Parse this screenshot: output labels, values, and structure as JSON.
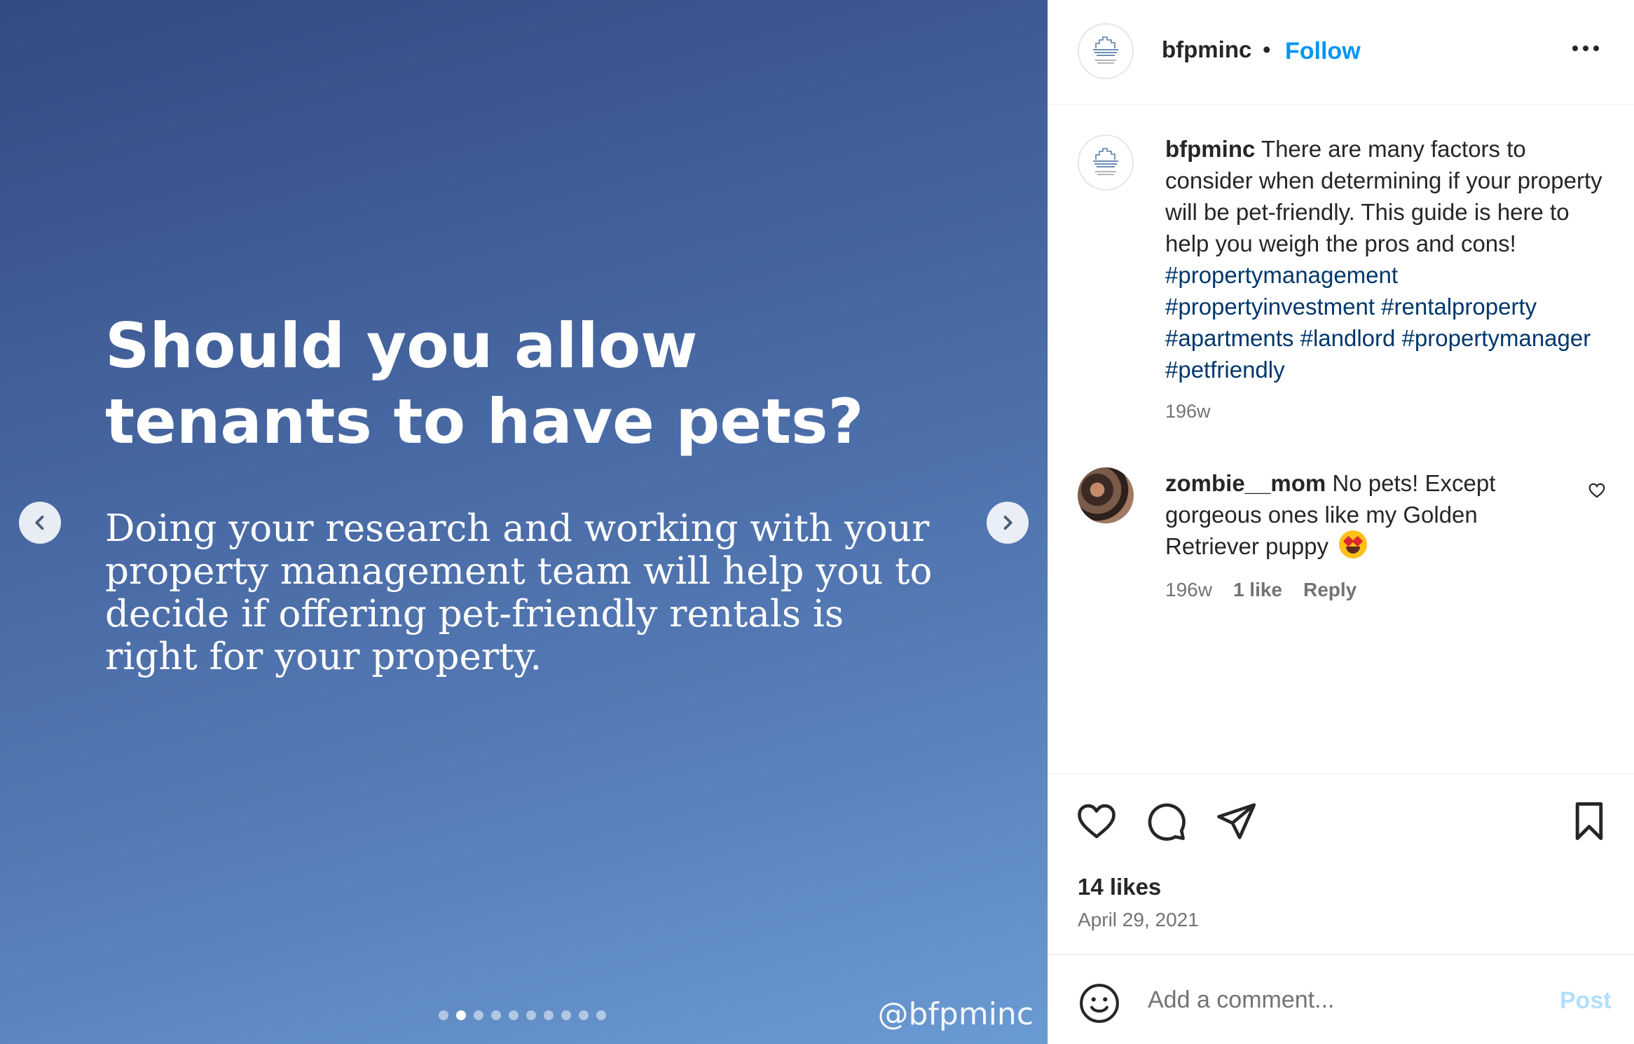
{
  "post": {
    "slide": {
      "title": "Should you allow tenants to have pets?",
      "body": "Doing your research and working with your property management team will help you to decide if offering pet-friendly rentals is right for your property.",
      "handle": "@bfpminc",
      "slide_count": 10,
      "active_slide": 2
    },
    "header": {
      "username": "bfpminc",
      "separator": "•",
      "follow_label": "Follow"
    },
    "caption": {
      "username": "bfpminc",
      "text": "There are many factors to consider when determining if your property will be pet-friendly. This guide is here to help you weigh the pros and cons!",
      "hashtags": [
        "#propertymanagement",
        "#propertyinvestment",
        "#rentalproperty",
        "#apartments",
        "#landlord",
        "#propertymanager",
        "#petfriendly"
      ],
      "time": "196w"
    },
    "comments": [
      {
        "username": "zombie__mom",
        "text": "No pets! Except gorgeous ones like my Golden Retriever puppy",
        "time": "196w",
        "likes": "1 like",
        "reply_label": "Reply"
      }
    ],
    "likes": "14 likes",
    "date": "April 29, 2021",
    "comment_box": {
      "placeholder": "Add a comment...",
      "post_label": "Post"
    },
    "colors": {
      "link": "#0095f6",
      "hashtag": "#00376b",
      "post_disabled": "#b2dffc"
    }
  }
}
